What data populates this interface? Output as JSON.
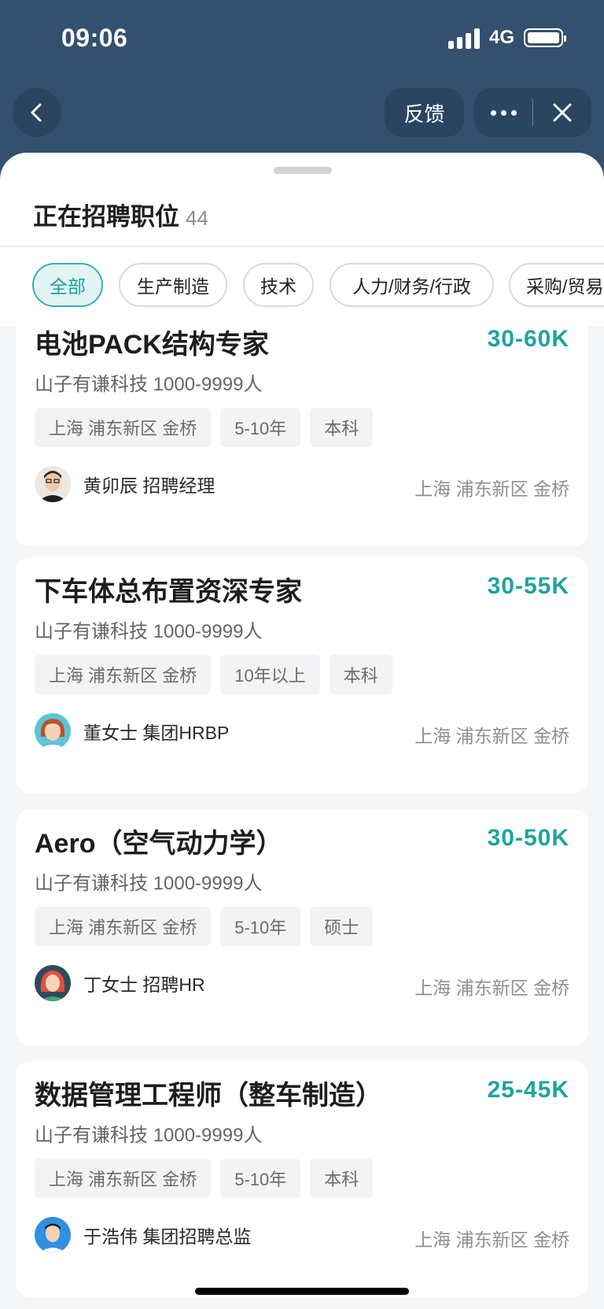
{
  "status_bar": {
    "time": "09:06",
    "network": "4G"
  },
  "nav": {
    "feedback_label": "反馈"
  },
  "header": {
    "title": "正在招聘职位",
    "count": "44"
  },
  "filters": [
    "全部",
    "生产制造",
    "技术",
    "人力/财务/行政",
    "采购/贸易"
  ],
  "jobs": [
    {
      "title": "电池PACK结构专家",
      "salary": "30-60K",
      "company": "山子有谦科技 1000-9999人",
      "tags": [
        "上海 浦东新区 金桥",
        "5-10年",
        "本科"
      ],
      "recruiter": "黄卯辰 招聘经理",
      "location": "上海 浦东新区 金桥"
    },
    {
      "title": "下车体总布置资深专家",
      "salary": "30-55K",
      "company": "山子有谦科技 1000-9999人",
      "tags": [
        "上海 浦东新区 金桥",
        "10年以上",
        "本科"
      ],
      "recruiter": "董女士 集团HRBP",
      "location": "上海 浦东新区 金桥"
    },
    {
      "title": "Aero（空气动力学）",
      "salary": "30-50K",
      "company": "山子有谦科技 1000-9999人",
      "tags": [
        "上海 浦东新区 金桥",
        "5-10年",
        "硕士"
      ],
      "recruiter": "丁女士 招聘HR",
      "location": "上海 浦东新区 金桥"
    },
    {
      "title": "数据管理工程师（整车制造）",
      "salary": "25-45K",
      "company": "山子有谦科技 1000-9999人",
      "tags": [
        "上海 浦东新区 金桥",
        "5-10年",
        "本科"
      ],
      "recruiter": "于浩伟 集团招聘总监",
      "location": "上海 浦东新区 金桥"
    }
  ]
}
